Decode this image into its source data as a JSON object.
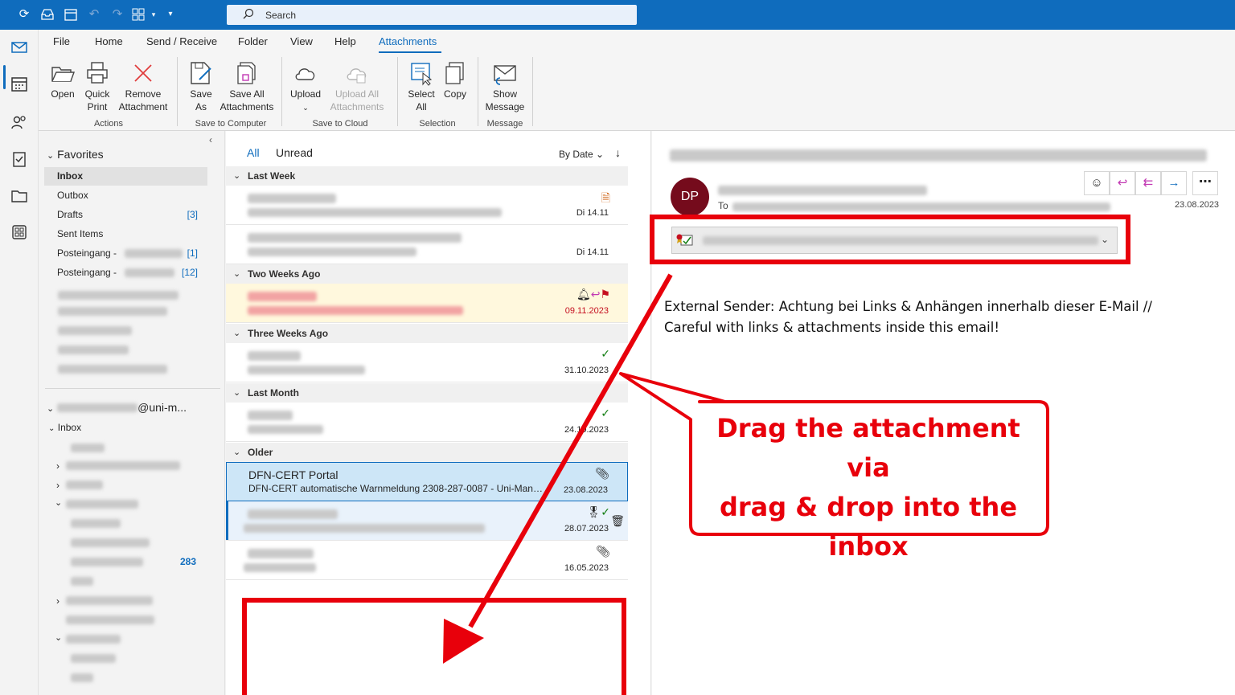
{
  "search": {
    "placeholder": "Search"
  },
  "ribbon": {
    "tabs": [
      "File",
      "Home",
      "Send / Receive",
      "Folder",
      "View",
      "Help",
      "Attachments"
    ],
    "active_tab": "Attachments",
    "buttons": {
      "open": "Open",
      "quick_print_1": "Quick",
      "quick_print_2": "Print",
      "remove_1": "Remove",
      "remove_2": "Attachment",
      "save_as_1": "Save",
      "save_as_2": "As",
      "save_all_1": "Save All",
      "save_all_2": "Attachments",
      "upload_1": "Upload",
      "upload_all_1": "Upload All",
      "upload_all_2": "Attachments",
      "select_all_1": "Select",
      "select_all_2": "All",
      "copy": "Copy",
      "show_msg_1": "Show",
      "show_msg_2": "Message"
    },
    "groups": {
      "actions": "Actions",
      "save_to_computer": "Save to Computer",
      "save_to_cloud": "Save to Cloud",
      "selection": "Selection",
      "message": "Message"
    }
  },
  "folders": {
    "favorites_header": "Favorites",
    "items": [
      {
        "label": "Inbox",
        "count": ""
      },
      {
        "label": "Outbox",
        "count": ""
      },
      {
        "label": "Drafts",
        "count": "[3]"
      },
      {
        "label": "Sent Items",
        "count": ""
      },
      {
        "label": "Posteingang -",
        "count": "[1]"
      },
      {
        "label": "Posteingang -",
        "count": "[12]"
      }
    ],
    "account_suffix": "@uni-m...",
    "account_inbox": "Inbox",
    "subfolder_count": "283"
  },
  "list": {
    "filter_all": "All",
    "filter_unread": "Unread",
    "sort_by": "By Date",
    "groups": [
      "Last Week",
      "Two Weeks Ago",
      "Three Weeks Ago",
      "Last Month",
      "Older"
    ],
    "dates": [
      "Di 14.11",
      "Di 14.11",
      "09.11.2023",
      "31.10.2023",
      "24.10.2023",
      "23.08.2023",
      "28.07.2023",
      "16.05.2023"
    ],
    "selected": {
      "sender": "DFN-CERT Portal",
      "subject": "DFN-CERT automatische Warnmeldung 2308-287-0087 - Uni-Mannh..."
    }
  },
  "reading": {
    "avatar": "DP",
    "to_label": "To",
    "date": "23.08.2023",
    "body_line1": "External Sender: Achtung bei Links & Anhängen innerhalb dieser E-Mail //",
    "body_line2": "Careful with links & attachments inside this email!"
  },
  "annotation": {
    "line1": "Drag the attachment via",
    "line2": "drag & drop into the",
    "line3": "inbox",
    "color": "#e8000b"
  },
  "colors": {
    "accent": "#0f6cbd",
    "avatar": "#750b1c",
    "annotation": "#e8000b"
  }
}
